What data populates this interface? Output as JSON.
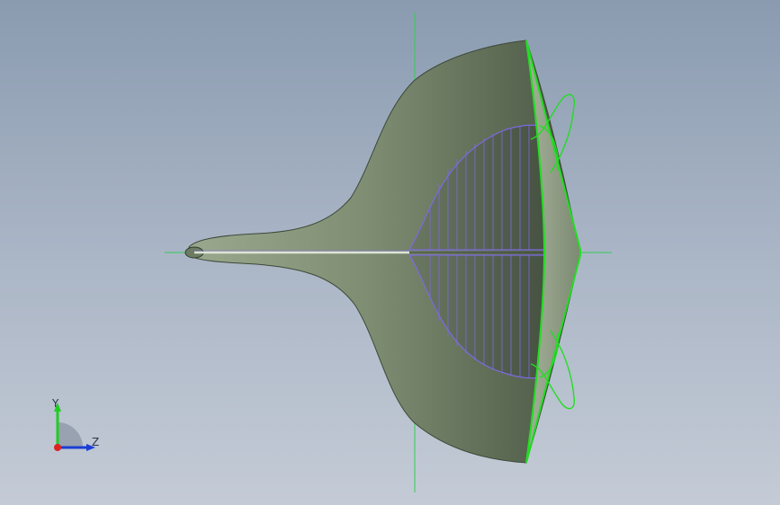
{
  "triad": {
    "y_label": "Y",
    "z_label": "Z"
  },
  "colors": {
    "background_top": "#8a9bb0",
    "background_bottom": "#c4cbd6",
    "surface": "#7f8f74",
    "surface_dark": "#4e5a48",
    "edge_green": "#22dd22",
    "section_purple": "#7d6ae0",
    "axis_line": "#33cc55",
    "triad_y": "#22cc22",
    "triad_z": "#1a3dd6",
    "triad_origin": "#dd2222"
  }
}
